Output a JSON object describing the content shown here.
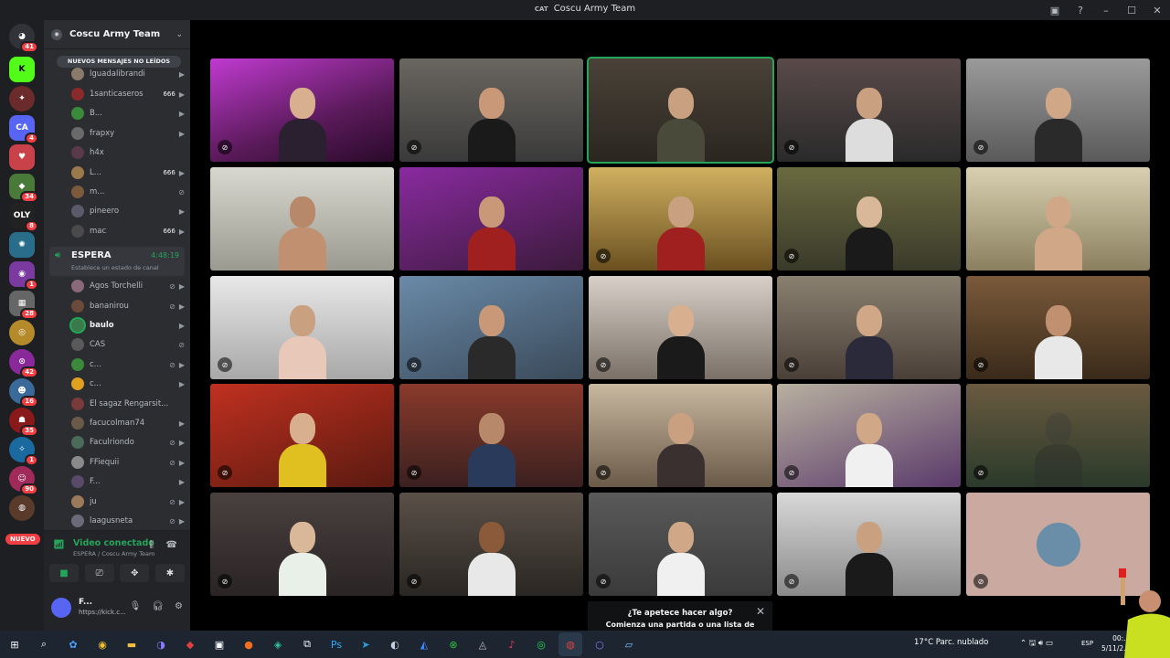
{
  "window": {
    "server_tag": "CAT",
    "title": "Coscu Army Team"
  },
  "guilds": {
    "badges": [
      "41",
      "4",
      "34",
      "8",
      "1",
      "28",
      "42",
      "16",
      "35",
      "1",
      "90"
    ],
    "new_label": "NUEVO"
  },
  "sidebar": {
    "server_name": "Coscu Army Team",
    "unread_label": "NUEVOS MENSAJES NO LEÍDOS",
    "members_above": [
      {
        "name": "lguadalibrandi"
      },
      {
        "name": "1santicaseros",
        "extra": "666"
      },
      {
        "name": "B..."
      },
      {
        "name": "frapxy"
      },
      {
        "name": "h4x"
      },
      {
        "name": "L...",
        "extra": "666"
      },
      {
        "name": "m..."
      },
      {
        "name": "pineero"
      },
      {
        "name": "mac",
        "extra": "666"
      }
    ],
    "voice_channel": {
      "name": "ESPERA",
      "timer": "4:48:19",
      "status_placeholder": "Establece un estado de canal"
    },
    "members": [
      {
        "name": "Agos Torchelli"
      },
      {
        "name": "bananirou"
      },
      {
        "name": "baulo"
      },
      {
        "name": "CAS"
      },
      {
        "name": "c..."
      },
      {
        "name": "c..."
      },
      {
        "name": "El sagaz Rengarsit..."
      },
      {
        "name": "facucolman74"
      },
      {
        "name": "Faculriondo"
      },
      {
        "name": "FFiequii"
      },
      {
        "name": "F..."
      },
      {
        "name": "ju"
      },
      {
        "name": "laagusneta"
      }
    ]
  },
  "voice_panel": {
    "title": "Video conectado",
    "subtitle": "ESPERA / Coscu Army Team"
  },
  "user_panel": {
    "name": "F...",
    "status": "https://kick.c..."
  },
  "toast": {
    "title": "¿Te apetece hacer algo?",
    "body": "Comienza una partida o una lista de"
  },
  "taskbar": {
    "weather": "17°C  Parc. nublado",
    "lang": "ESP",
    "time": "00:...",
    "date": "5/11/2..."
  },
  "colors": {
    "accent": "#5865f2",
    "online": "#23a55a",
    "badge": "#f23f43"
  }
}
